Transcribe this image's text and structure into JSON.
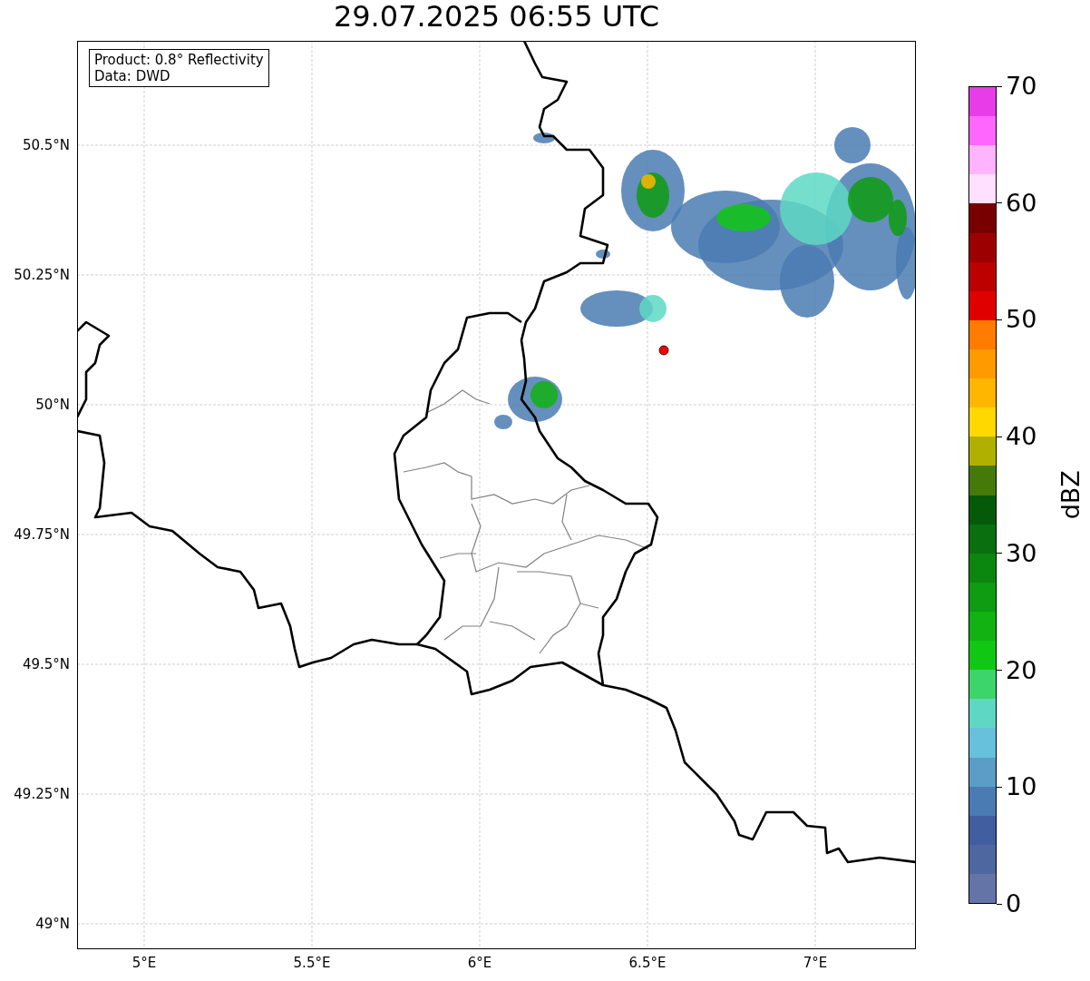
{
  "title": "29.07.2025 06:55 UTC",
  "info_box": {
    "lines": [
      "Product: 0.8° Reflectivity",
      "Data: DWD"
    ]
  },
  "map": {
    "y_labels": [
      "50.5°N",
      "50.25°N",
      "50°N",
      "49.75°N",
      "49.5°N",
      "49.25°N",
      "49°N"
    ],
    "x_labels": [
      "5°E",
      "5.5°E",
      "6°E",
      "6.5°E",
      "7°E"
    ]
  },
  "colorbar": {
    "label": "dBZ",
    "ticks": [
      "70",
      "60",
      "50",
      "40",
      "30",
      "20",
      "10",
      "0"
    ],
    "bins": [
      {
        "color": "#e83ce8"
      },
      {
        "color": "#fe66fe"
      },
      {
        "color": "#ffb4ff"
      },
      {
        "color": "#ffe0ff"
      },
      {
        "color": "#780000"
      },
      {
        "color": "#9c0000"
      },
      {
        "color": "#bc0000"
      },
      {
        "color": "#e00000"
      },
      {
        "color": "#ff7c00"
      },
      {
        "color": "#ff9a00"
      },
      {
        "color": "#ffb600"
      },
      {
        "color": "#ffd800"
      },
      {
        "color": "#b0b000"
      },
      {
        "color": "#457a0a"
      },
      {
        "color": "#055a0a"
      },
      {
        "color": "#0a700f"
      },
      {
        "color": "#0b860f"
      },
      {
        "color": "#0e9c12"
      },
      {
        "color": "#11b212"
      },
      {
        "color": "#10c814"
      },
      {
        "color": "#3cd56b"
      },
      {
        "color": "#5ed8c3"
      },
      {
        "color": "#67c0dc"
      },
      {
        "color": "#5b9dc6"
      },
      {
        "color": "#4a7bb2"
      },
      {
        "color": "#415ea0"
      },
      {
        "color": "#4f67a0"
      },
      {
        "color": "#6474a6"
      }
    ]
  }
}
